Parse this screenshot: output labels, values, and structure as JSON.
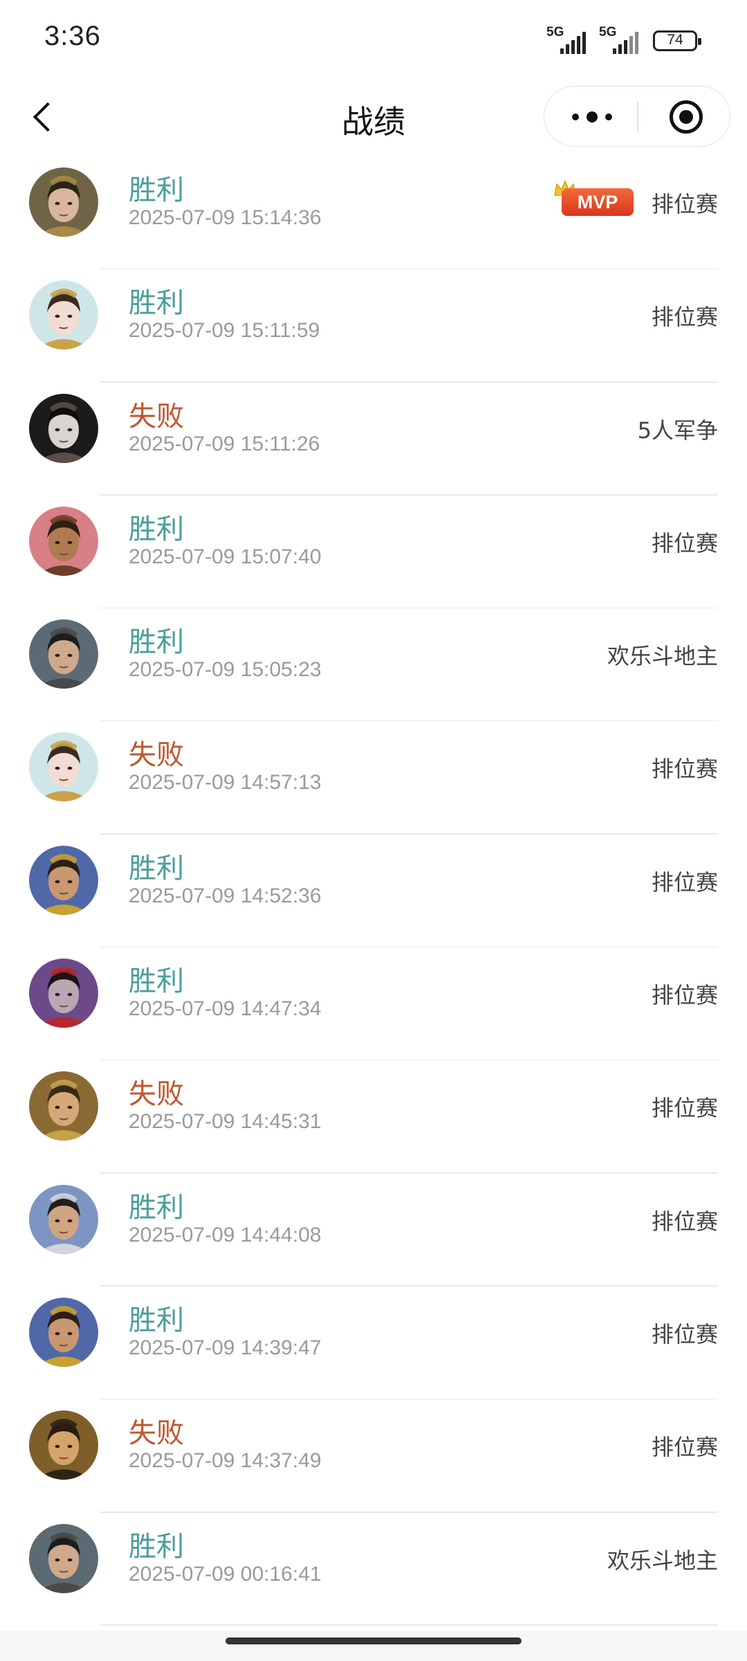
{
  "status_bar": {
    "time": "3:36",
    "signal_1": "5G",
    "signal_2": "5G",
    "battery": "74"
  },
  "nav": {
    "title": "战绩"
  },
  "colors": {
    "win": "#4a9e9a",
    "lose": "#c2562e",
    "mvp": "#e0452a"
  },
  "records": [
    {
      "result": "胜利",
      "outcome": "win",
      "time": "2025-07-09 15:14:36",
      "mode": "排位赛",
      "mvp": "MVP",
      "avatar": "hero-portrait-1"
    },
    {
      "result": "胜利",
      "outcome": "win",
      "time": "2025-07-09 15:11:59",
      "mode": "排位赛",
      "avatar": "hero-portrait-2"
    },
    {
      "result": "失败",
      "outcome": "lose",
      "time": "2025-07-09 15:11:26",
      "mode": "5人军争",
      "avatar": "hero-portrait-3"
    },
    {
      "result": "胜利",
      "outcome": "win",
      "time": "2025-07-09 15:07:40",
      "mode": "排位赛",
      "avatar": "hero-portrait-4"
    },
    {
      "result": "胜利",
      "outcome": "win",
      "time": "2025-07-09 15:05:23",
      "mode": "欢乐斗地主",
      "avatar": "hero-portrait-5"
    },
    {
      "result": "失败",
      "outcome": "lose",
      "time": "2025-07-09 14:57:13",
      "mode": "排位赛",
      "avatar": "hero-portrait-2"
    },
    {
      "result": "胜利",
      "outcome": "win",
      "time": "2025-07-09 14:52:36",
      "mode": "排位赛",
      "avatar": "hero-portrait-6"
    },
    {
      "result": "胜利",
      "outcome": "win",
      "time": "2025-07-09 14:47:34",
      "mode": "排位赛",
      "avatar": "hero-portrait-7"
    },
    {
      "result": "失败",
      "outcome": "lose",
      "time": "2025-07-09 14:45:31",
      "mode": "排位赛",
      "avatar": "hero-portrait-8"
    },
    {
      "result": "胜利",
      "outcome": "win",
      "time": "2025-07-09 14:44:08",
      "mode": "排位赛",
      "avatar": "hero-portrait-9"
    },
    {
      "result": "胜利",
      "outcome": "win",
      "time": "2025-07-09 14:39:47",
      "mode": "排位赛",
      "avatar": "hero-portrait-6"
    },
    {
      "result": "失败",
      "outcome": "lose",
      "time": "2025-07-09 14:37:49",
      "mode": "排位赛",
      "avatar": "hero-portrait-10"
    },
    {
      "result": "胜利",
      "outcome": "win",
      "time": "2025-07-09 00:16:41",
      "mode": "欢乐斗地主",
      "avatar": "hero-portrait-5"
    }
  ]
}
